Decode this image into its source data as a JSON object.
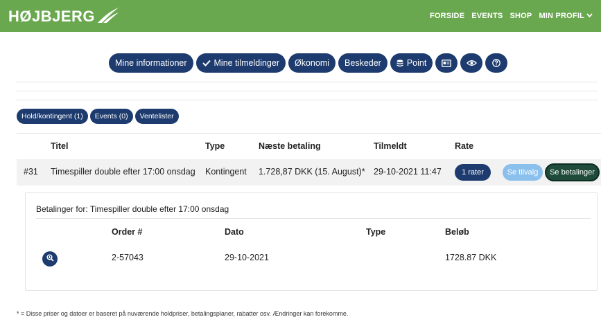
{
  "header": {
    "logo_text": "HØJBJERG",
    "nav": {
      "forside": "FORSIDE",
      "events": "EVENTS",
      "shop": "SHOP",
      "min_profil": "MIN PROFIL"
    },
    "bar_color": "#6aa84f"
  },
  "tabs": {
    "mine_informationer": "Mine informationer",
    "mine_tilmeldinger": "Mine tilmeldinger",
    "okonomi": "Økonomi",
    "beskeder": "Beskeder",
    "point": "Point",
    "icons": [
      "id-card-icon",
      "eye-icon",
      "help-icon"
    ]
  },
  "subtabs": {
    "hold": "Hold/kontingent (1)",
    "events": "Events (0)",
    "ventelister": "Ventelister"
  },
  "table": {
    "headers": {
      "titel": "Titel",
      "type": "Type",
      "naeste_betaling": "Næste betaling",
      "tilmeldt": "Tilmeldt",
      "rate": "Rate"
    },
    "row": {
      "id": "#31",
      "titel": "Timespiller double efter 17:00 onsdag",
      "type": "Kontingent",
      "naeste_betaling": "1.728,87 DKK (15. August)*",
      "tilmeldt": "29-10-2021 11:47",
      "rate_button": "1 rater",
      "tilvalg_button": "Se tilvalg",
      "betalinger_button": "Se betalinger"
    }
  },
  "payments": {
    "title": "Betalinger for: Timespiller double efter 17:00 onsdag",
    "headers": {
      "order": "Order #",
      "dato": "Dato",
      "type": "Type",
      "belob": "Beløb"
    },
    "row": {
      "order": "2-57043",
      "dato": "29-10-2021",
      "type": "",
      "belob": "1728.87 DKK"
    }
  },
  "footnote": "* = Disse priser og datoer er baseret på nuværende holdpriser, betalingsplaner, rabatter osv. Ændringer kan forekomme.",
  "colors": {
    "primary": "#1d3b6e",
    "light_blue": "#8cc0ec",
    "dark_green": "#1e4b3a"
  }
}
